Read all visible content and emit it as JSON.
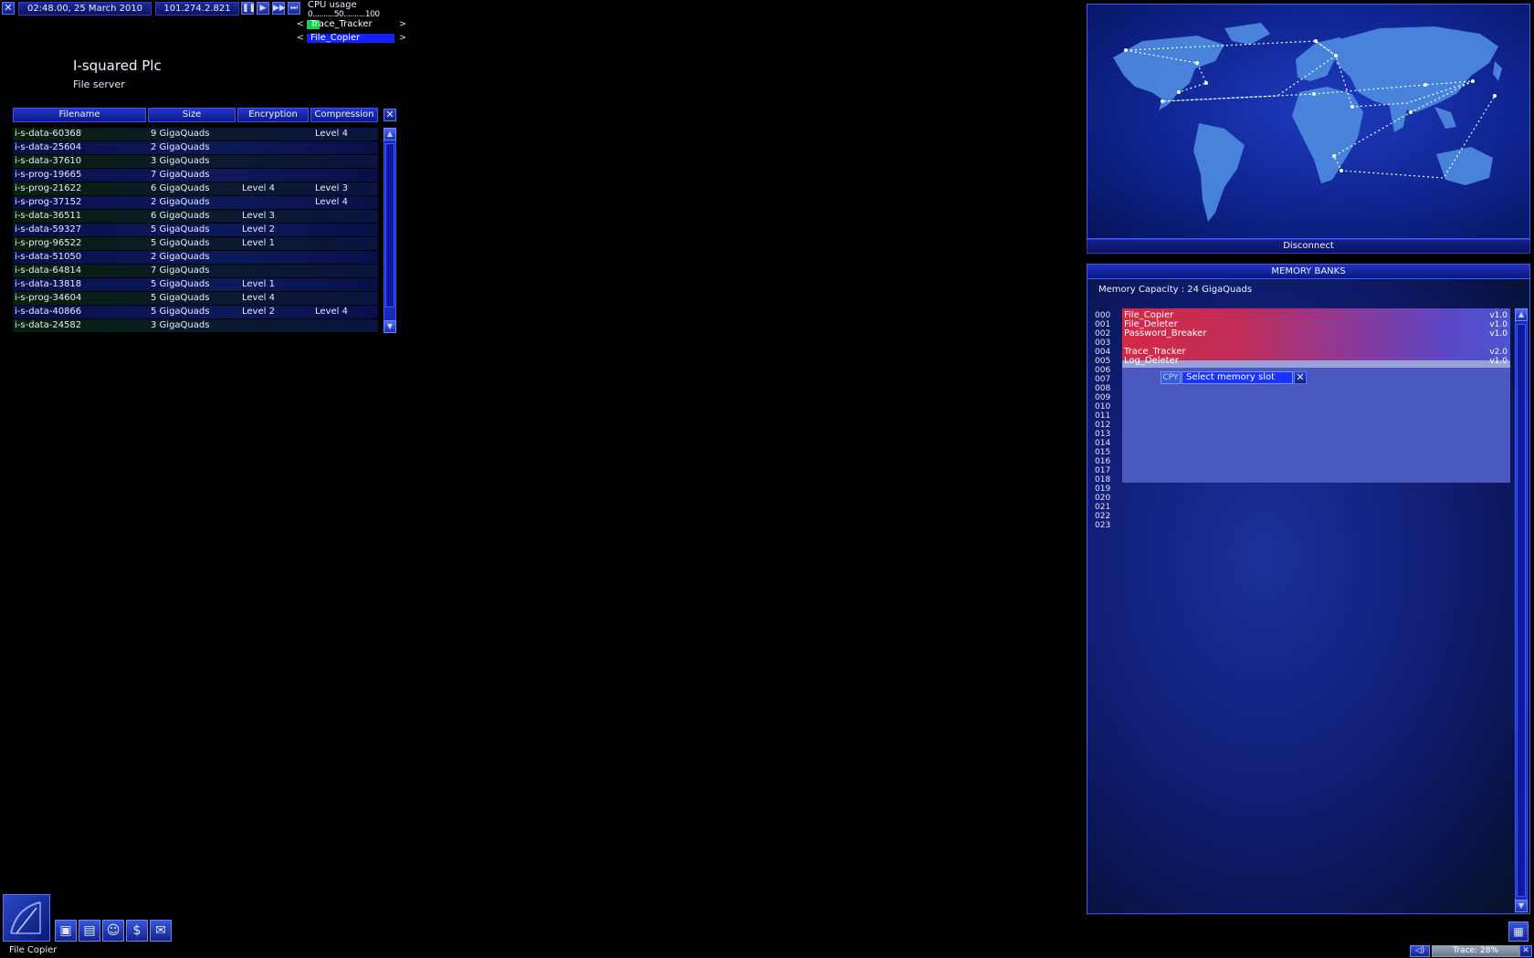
{
  "topbar": {
    "datetime": "02:48.00, 25 March 2010",
    "ip": "101.274.2.821",
    "cpu_label": "CPU usage",
    "cpu_scale": "0..........50..........100",
    "programs": [
      {
        "name": "Trace_Tracker"
      },
      {
        "name": "File_Copier"
      }
    ]
  },
  "company": {
    "title": "I-squared Plc",
    "subtitle": "File server"
  },
  "file_table": {
    "columns": [
      "Filename",
      "Size",
      "Encryption",
      "Compression"
    ],
    "rows": [
      {
        "filename": "i-s-data-60368",
        "size": "9 GigaQuads",
        "encryption": "",
        "compression": "Level 4"
      },
      {
        "filename": "i-s-data-25604",
        "size": "2 GigaQuads",
        "encryption": "",
        "compression": ""
      },
      {
        "filename": "i-s-data-37610",
        "size": "3 GigaQuads",
        "encryption": "",
        "compression": ""
      },
      {
        "filename": "i-s-prog-19665",
        "size": "7 GigaQuads",
        "encryption": "",
        "compression": ""
      },
      {
        "filename": "i-s-prog-21622",
        "size": "6 GigaQuads",
        "encryption": "Level 4",
        "compression": "Level 3"
      },
      {
        "filename": "i-s-prog-37152",
        "size": "2 GigaQuads",
        "encryption": "",
        "compression": "Level 4"
      },
      {
        "filename": "i-s-data-36511",
        "size": "6 GigaQuads",
        "encryption": "Level 3",
        "compression": ""
      },
      {
        "filename": "i-s-data-59327",
        "size": "5 GigaQuads",
        "encryption": "Level 2",
        "compression": ""
      },
      {
        "filename": "i-s-prog-96522",
        "size": "5 GigaQuads",
        "encryption": "Level 1",
        "compression": ""
      },
      {
        "filename": "i-s-data-51050",
        "size": "2 GigaQuads",
        "encryption": "",
        "compression": ""
      },
      {
        "filename": "i-s-data-64814",
        "size": "7 GigaQuads",
        "encryption": "",
        "compression": ""
      },
      {
        "filename": "i-s-data-13818",
        "size": "5 GigaQuads",
        "encryption": "Level 1",
        "compression": ""
      },
      {
        "filename": "i-s-prog-34604",
        "size": "5 GigaQuads",
        "encryption": "Level 4",
        "compression": ""
      },
      {
        "filename": "i-s-data-40866",
        "size": "5 GigaQuads",
        "encryption": "Level 2",
        "compression": "Level 4"
      },
      {
        "filename": "i-s-data-24582",
        "size": "3 GigaQuads",
        "encryption": "",
        "compression": ""
      }
    ]
  },
  "map": {
    "disconnect_label": "Disconnect"
  },
  "memory": {
    "title": "MEMORY BANKS",
    "capacity": "Memory Capacity : 24 GigaQuads",
    "slots": [
      "000",
      "001",
      "002",
      "003",
      "004",
      "005",
      "006",
      "007",
      "008",
      "009",
      "010",
      "011",
      "012",
      "013",
      "014",
      "015",
      "016",
      "017",
      "018",
      "019",
      "020",
      "021",
      "022",
      "023"
    ],
    "programs": [
      {
        "slot": "000",
        "name": "File_Copier",
        "version": "v1.0"
      },
      {
        "slot": "001",
        "name": "File_Deleter",
        "version": "v1.0"
      },
      {
        "slot": "002",
        "name": "Password_Breaker",
        "version": "v1.0"
      },
      {
        "slot": "004",
        "name": "Trace_Tracker",
        "version": "v2.0"
      },
      {
        "slot": "005",
        "name": "Log_Deleter",
        "version": "v1.0"
      }
    ],
    "dialog": {
      "tag": "CPY",
      "label": "Select memory slot"
    }
  },
  "bottom": {
    "active_tool": "File Copier",
    "trace": "Trace: 28%"
  },
  "colors": {
    "panel_blue": "#1a2ab8",
    "memory_used": "#c8284a",
    "memory_free": "#4f5cc4"
  }
}
